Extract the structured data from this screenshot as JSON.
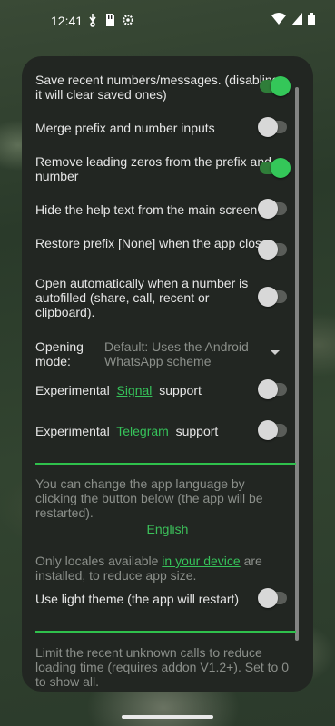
{
  "status_bar": {
    "time": "12:41"
  },
  "settings": [
    {
      "label": "Save recent numbers/messages. (disabling it will clear saved ones)",
      "toggle": "on"
    },
    {
      "label": "Merge prefix and number inputs",
      "toggle": "off"
    },
    {
      "label": "Remove leading zeros from the prefix and number",
      "toggle": "on"
    },
    {
      "label": "Hide the help text from the main screen",
      "toggle": "off"
    },
    {
      "label": "Restore prefix [None] when the app closes.",
      "toggle": "off"
    },
    {
      "label": "Open automatically when a number is autofilled (share, call, recent or clipboard).",
      "toggle": "off"
    }
  ],
  "opening_mode": {
    "label": "Opening mode:",
    "value": "Default: Uses the Android WhatsApp scheme"
  },
  "experimental": [
    {
      "prefix": "Experimental",
      "link": "Signal",
      "suffix": "support",
      "toggle": "off"
    },
    {
      "prefix": "Experimental",
      "link": "Telegram",
      "suffix": "support",
      "toggle": "off"
    }
  ],
  "language": {
    "help": "You can change the app language by clicking the button below (the app will be restarted).",
    "button": "English",
    "note_prefix": "Only locales available",
    "note_link": "in your device",
    "note_suffix": "are installed, to reduce app size."
  },
  "light_theme": {
    "label": "Use light theme (the app will restart)",
    "toggle": "off"
  },
  "recent_calls_help": "Limit the recent unknown calls to reduce loading time (requires addon V1.2+). Set to 0 to show all."
}
